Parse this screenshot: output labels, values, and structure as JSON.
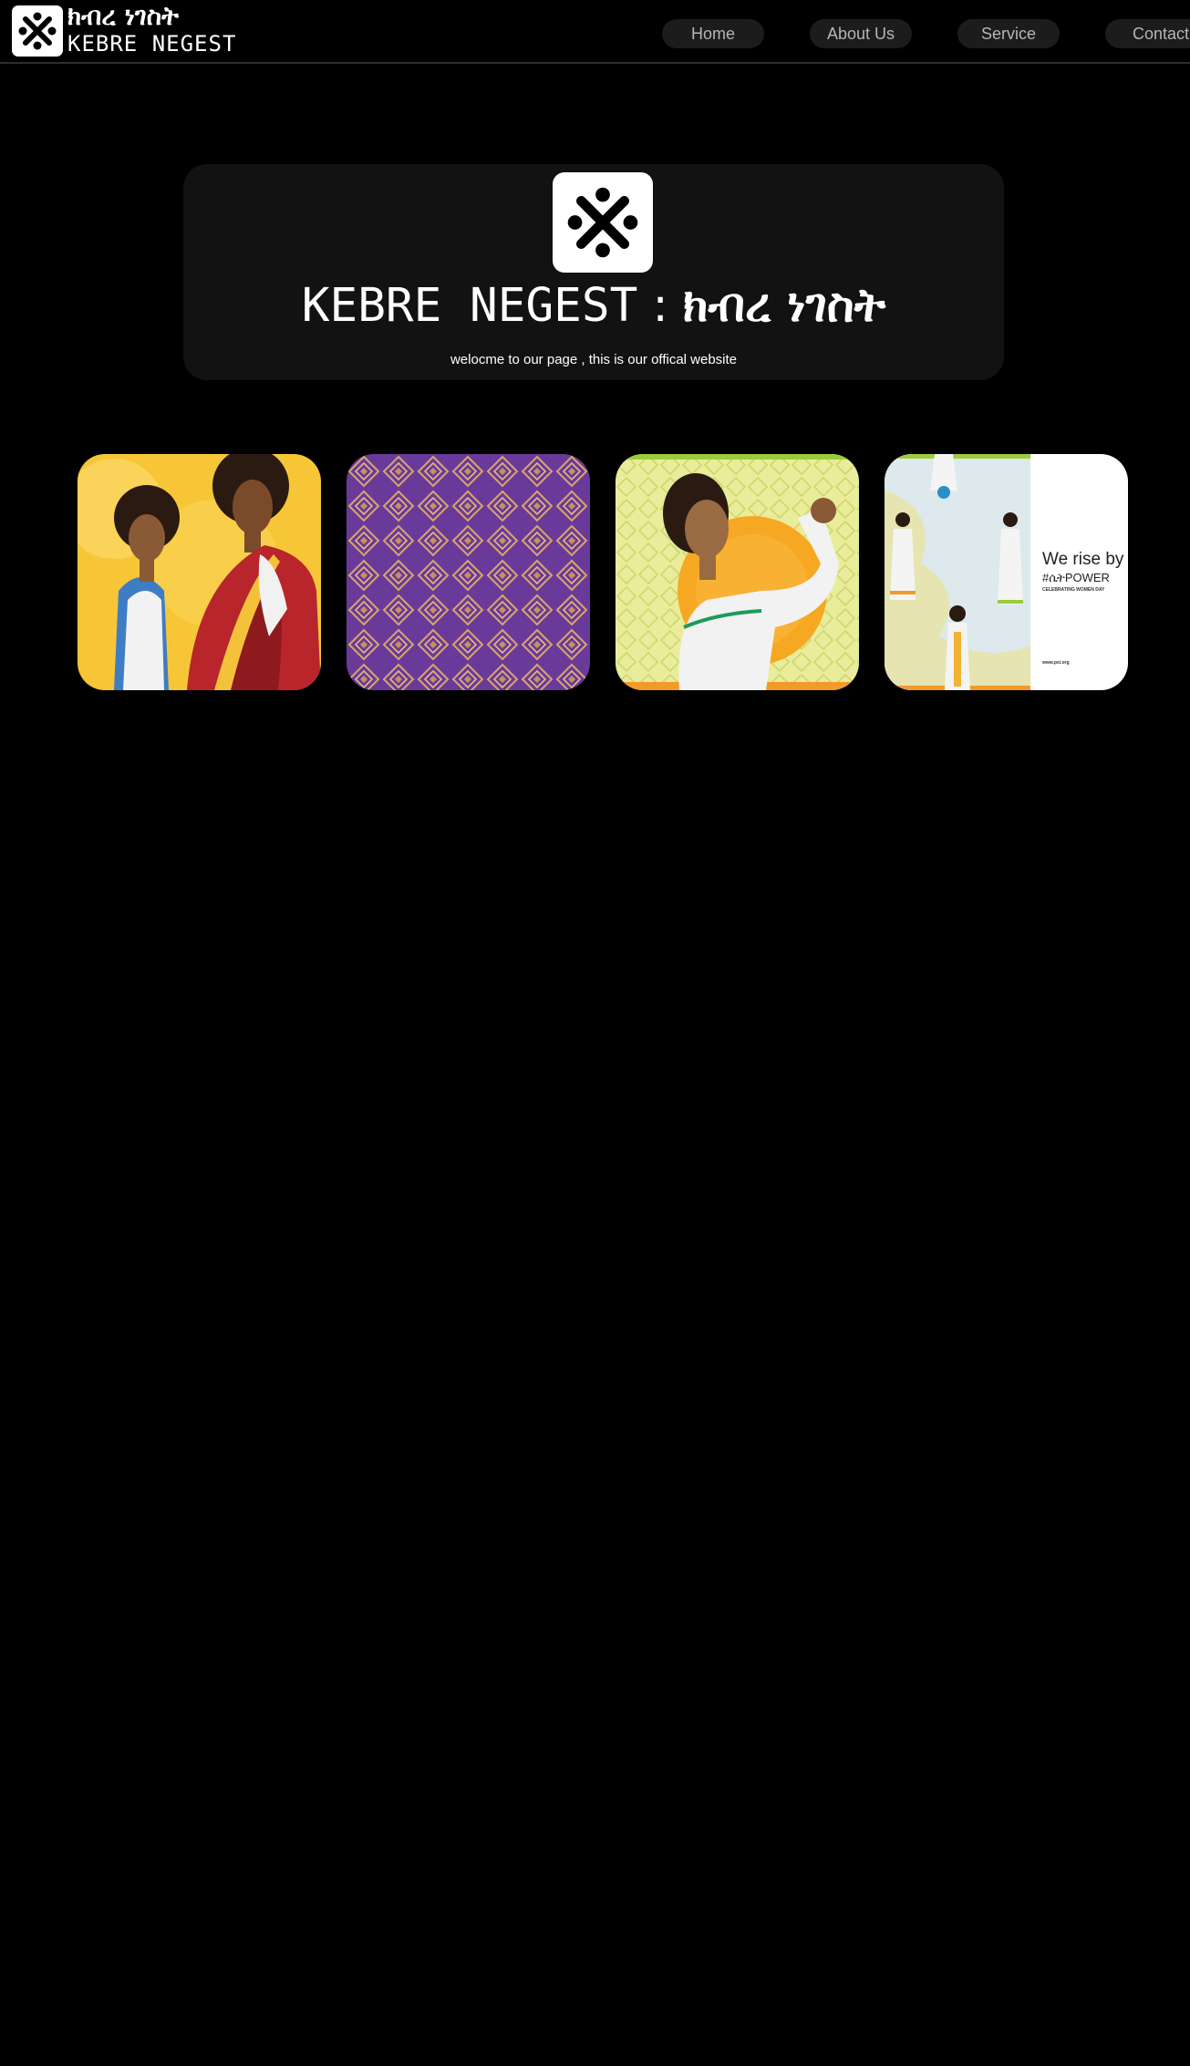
{
  "header": {
    "logo_icon": "cross-knot-icon",
    "brand_amharic": "ክብረ ነገስት",
    "brand_english": "KEBRE NEGEST",
    "nav": [
      {
        "label": "Home"
      },
      {
        "label": "About Us"
      },
      {
        "label": "Service"
      },
      {
        "label": "Contact"
      }
    ]
  },
  "hero": {
    "logo_icon": "cross-knot-icon",
    "title_english": "KEBRE NEGEST",
    "title_separator": ":",
    "title_amharic": "ክብረ ነገስት",
    "subtitle": "welocme to our page , this is our offical website"
  },
  "gallery": {
    "cards": [
      {
        "image": "two-women-illustration"
      },
      {
        "image": "purple-pattern"
      },
      {
        "image": "woman-flexing-illustration"
      },
      {
        "image": "women-day-poster",
        "headline": "We rise by l",
        "hashtag": "#ሴትPOWER",
        "caption": "CELEBRATING WOMEN DAY",
        "url": "www.psi.org"
      }
    ]
  },
  "colors": {
    "background": "#000000",
    "header_border": "#2e2e2e",
    "nav_pill": "#1c1c1c",
    "hero_panel": "#121212",
    "accent_purple": "#6a3a9a",
    "accent_yellow": "#f7c637"
  }
}
